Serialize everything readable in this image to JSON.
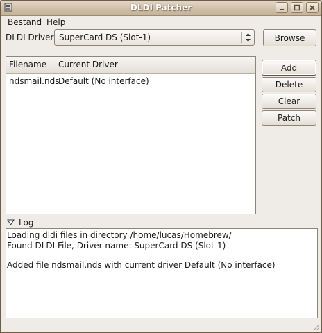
{
  "window": {
    "title": "DLDI Patcher"
  },
  "menu": {
    "items": [
      "Bestand",
      "Help"
    ]
  },
  "driver": {
    "label": "DLDI Driver:",
    "selected": "SuperCard DS (Slot-1)",
    "browse_label": "Browse"
  },
  "filelist": {
    "columns": [
      "Filename",
      "Current Driver"
    ],
    "rows": [
      {
        "filename": "ndsmail.nds",
        "driver": "Default (No interface)"
      }
    ]
  },
  "actions": {
    "add": "Add",
    "delete": "Delete",
    "clear": "Clear",
    "patch": "Patch"
  },
  "log": {
    "label": "Log",
    "expanded": true,
    "lines": [
      "Loading dldi files in directory /home/lucas/Homebrew/",
      "Found DLDI File, Driver name: SuperCard DS (Slot-1)",
      "",
      "Added file ndsmail.nds with current driver Default (No interface)"
    ]
  },
  "icons": [
    "app-icon",
    "minimize-icon",
    "maximize-icon",
    "close-icon",
    "combo-arrows-icon",
    "expander-icon",
    "resize-grip-icon"
  ]
}
